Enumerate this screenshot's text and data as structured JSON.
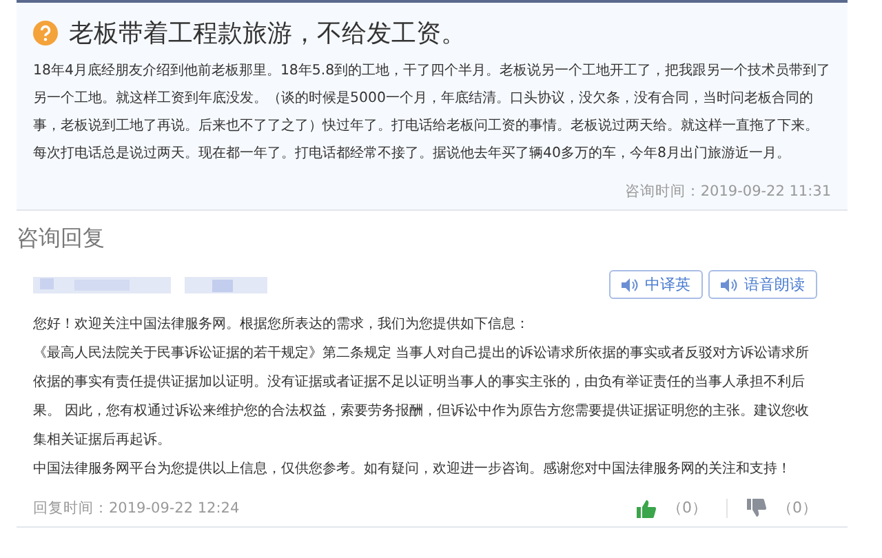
{
  "question": {
    "title": "老板带着工程款旅游，不给发工资。",
    "body": "18年4月底经朋友介绍到他前老板那里。18年5.8到的工地，干了四个半月。老板说另一个工地开工了，把我跟另一个技术员带到了另一个工地。就这样工资到年底没发。（谈的时候是5000一个月，年底结清。口头协议，没欠条，没有合同，当时问老板合同的事，老板说到工地了再说。后来也不了了之了）快过年了。打电话给老板问工资的事情。老板说过两天给。就这样一直拖了下来。每次打电话总是说过两天。现在都一年了。打电话都经常不接了。据说他去年买了辆40多万的车，今年8月出门旅游近一月。",
    "time": "咨询时间：2019-09-22 11:31"
  },
  "reply_heading": "咨询回复",
  "reply": {
    "buttons": [
      "中译英",
      "语音朗读"
    ],
    "paragraphs": [
      "您好！欢迎关注中国法律服务网。根据您所表达的需求，我们为您提供如下信息：",
      "《最高人民法院关于民事诉讼证据的若干规定》第二条规定 当事人对自己提出的诉讼请求所依据的事实或者反驳对方诉讼请求所依据的事实有责任提供证据加以证明。没有证据或者证据不足以证明当事人的事实主张的，由负有举证责任的当事人承担不利后果。 因此，您有权通过诉讼来维护您的合法权益，索要劳务报酬，但诉讼中作为原告方您需要提供证据证明您的主张。建议您收集相关证据后再起诉。",
      "中国法律服务网平台为您提供以上信息，仅供您参考。如有疑问，欢迎进一步咨询。感谢您对中国法律服务网的关注和支持！"
    ],
    "time": "回复时间：2019-09-22 12:24",
    "likes": "（0）",
    "dislikes": "（0）"
  }
}
